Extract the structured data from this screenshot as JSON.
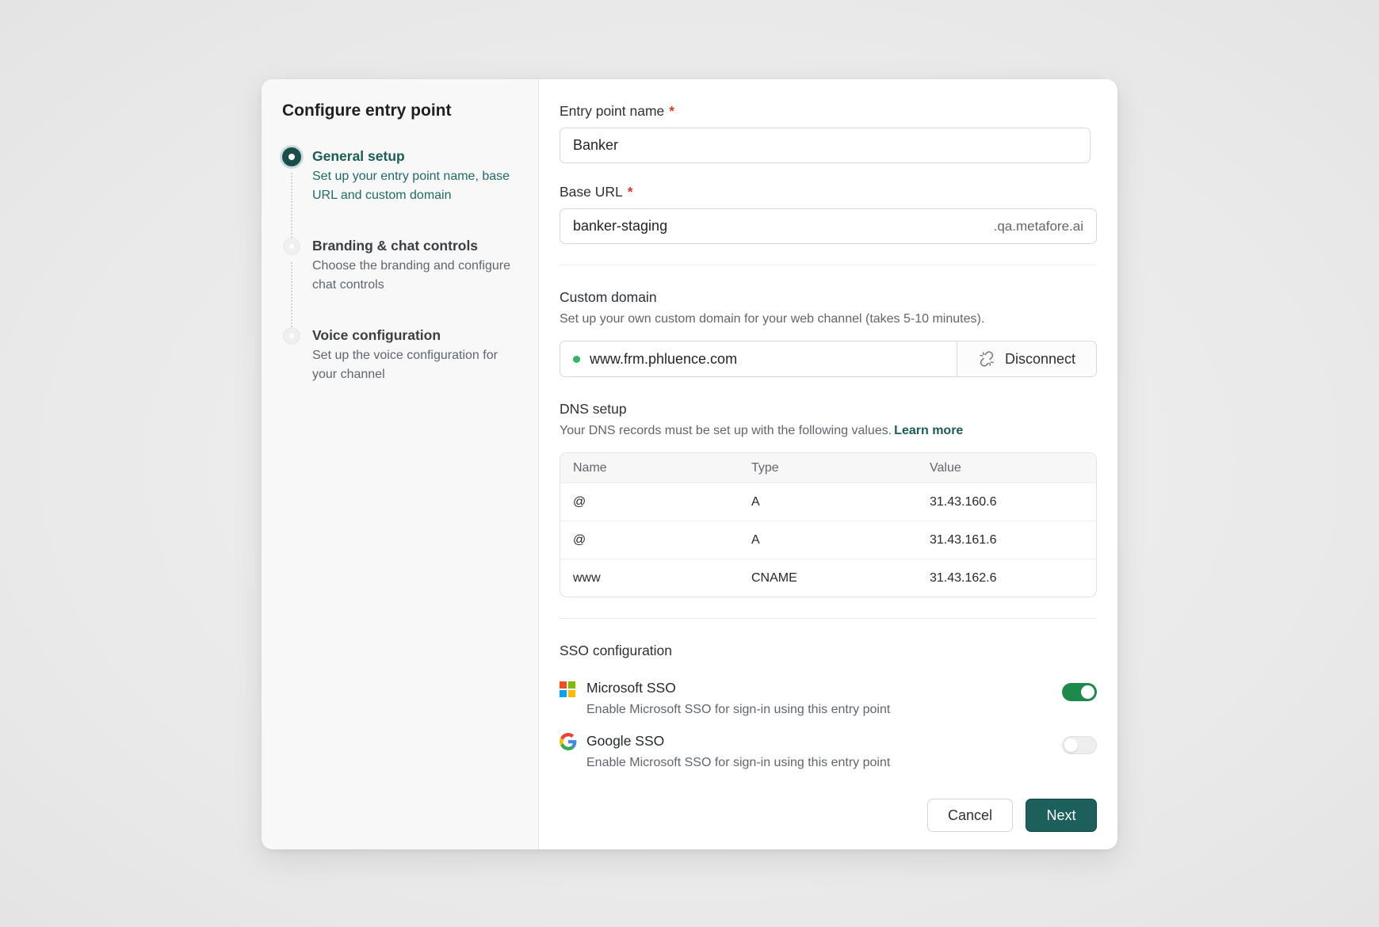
{
  "wizard": {
    "title": "Configure entry point",
    "steps": [
      {
        "name": "General setup",
        "desc": "Set up your entry point name, base URL and custom domain",
        "state": "active"
      },
      {
        "name": "Branding & chat controls",
        "desc": "Choose the branding and configure chat controls",
        "state": "pending"
      },
      {
        "name": "Voice configuration",
        "desc": "Set up the voice configuration for your channel",
        "state": "pending"
      }
    ]
  },
  "form": {
    "entry_name": {
      "label": "Entry point name",
      "required_mark": "*",
      "value": "Banker"
    },
    "base_url": {
      "label": "Base URL",
      "required_mark": "*",
      "value": "banker-staging",
      "suffix": ".qa.metafore.ai"
    },
    "custom_domain": {
      "title": "Custom domain",
      "subtitle": "Set up your own custom domain for your web channel (takes 5-10 minutes).",
      "value": "www.frm.phluence.com",
      "status": "connected",
      "disconnect_label": "Disconnect"
    },
    "dns": {
      "title": "DNS setup",
      "subtitle": "Your DNS records must be set up with the following values.",
      "link": "Learn more",
      "columns": [
        "Name",
        "Type",
        "Value"
      ],
      "rows": [
        [
          "@",
          "A",
          "31.43.160.6"
        ],
        [
          "@",
          "A",
          "31.43.161.6"
        ],
        [
          "www",
          "CNAME",
          "31.43.162.6"
        ]
      ]
    },
    "sso": {
      "title": "SSO configuration",
      "items": [
        {
          "name": "Microsoft SSO",
          "desc": "Enable Microsoft SSO for sign-in using this entry point",
          "enabled": true,
          "icon": "microsoft-icon"
        },
        {
          "name": "Google SSO",
          "desc": "Enable Microsoft SSO for sign-in using this entry point",
          "enabled": false,
          "icon": "google-icon"
        }
      ]
    }
  },
  "actions": {
    "cancel": "Cancel",
    "next": "Next"
  },
  "colors": {
    "accent": "#1c5f5b",
    "toggle_on": "#1d8a4b",
    "required": "#d73a2e",
    "status_ok": "#2fb764"
  }
}
